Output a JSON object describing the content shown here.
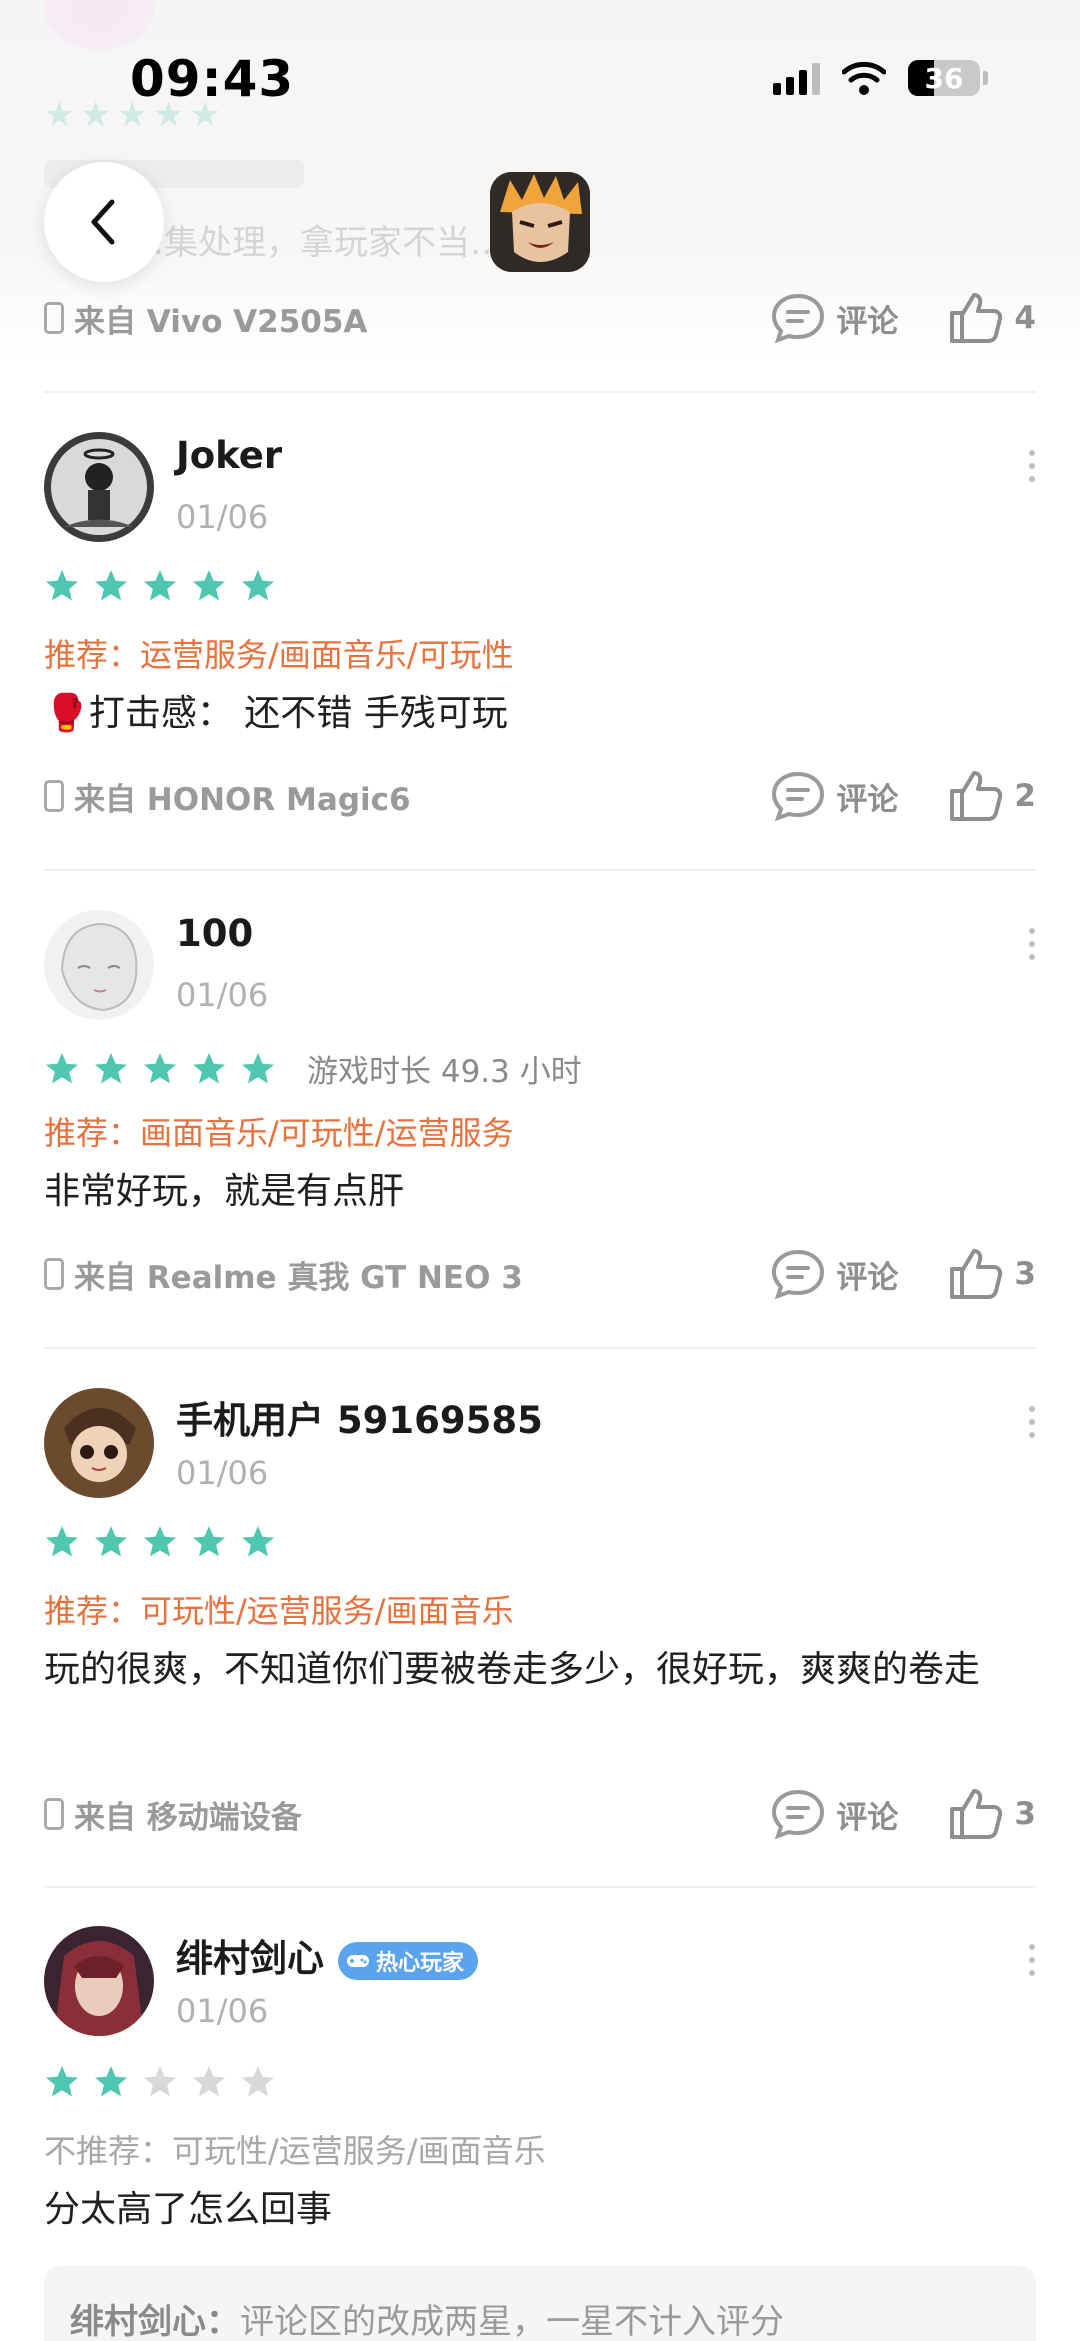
{
  "status_bar": {
    "time": "09:43",
    "battery": "36"
  },
  "top": {
    "ghost_text": "…集处理，拿玩家不当…",
    "prev_review": {
      "device": "来自 Vivo V2505A",
      "comment_label": "评论",
      "likes": "4"
    }
  },
  "reviews": [
    {
      "username": "Joker",
      "date": "01/06",
      "rating": 5,
      "recommend": "推荐：运营服务/画面音乐/可玩性",
      "text": "🥊打击感：  还不错 手残可玩",
      "device": "来自 HONOR Magic6",
      "comment_label": "评论",
      "likes": "2"
    },
    {
      "username": "100",
      "date": "01/06",
      "rating": 5,
      "playtime": "游戏时长 49.3 小时",
      "recommend": "推荐：画面音乐/可玩性/运营服务",
      "text": "非常好玩，就是有点肝",
      "device": "来自 Realme 真我 GT NEO 3",
      "comment_label": "评论",
      "likes": "3"
    },
    {
      "username": "手机用户 59169585",
      "date": "01/06",
      "rating": 5,
      "recommend": "推荐：可玩性/运营服务/画面音乐",
      "text": "玩的很爽，不知道你们要被卷走多少，很好玩，爽爽的卷走",
      "device": "来自 移动端设备",
      "comment_label": "评论",
      "likes": "3"
    },
    {
      "username": "绯村剑心",
      "badge": "热心玩家",
      "date": "01/06",
      "rating": 2,
      "recommend": "不推荐：可玩性/运营服务/画面音乐",
      "text": "分太高了怎么回事",
      "reply_author": "绯村剑心：",
      "reply_text": "评论区的改成两星，一星不计入评分"
    }
  ],
  "colors": {
    "star_on": "#4fc7b0",
    "star_off": "#d8d8d8",
    "recommend": "#e9713c",
    "badge": "#5aa4ef"
  },
  "icons": [
    "back-arrow-icon",
    "comment-icon",
    "thumbs-up-icon",
    "phone-icon",
    "more-icon",
    "star-icon",
    "gamepad-icon"
  ]
}
